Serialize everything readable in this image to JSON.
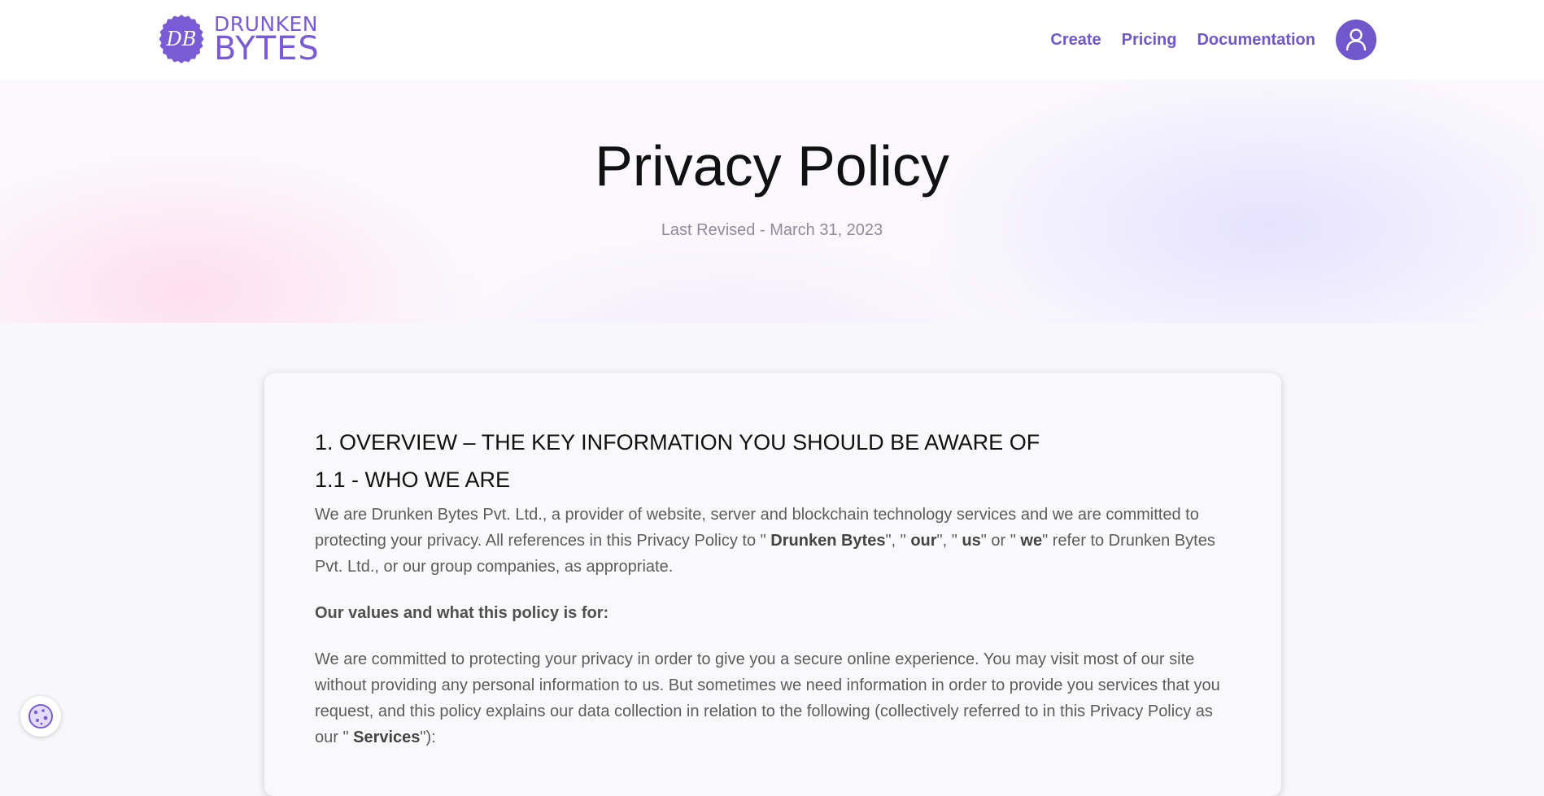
{
  "brand": {
    "logo_initials": "DB",
    "name_line1": "DRUNKEN",
    "name_line2": "BYTES",
    "color": "#7a5bd6"
  },
  "nav": {
    "create": "Create",
    "pricing": "Pricing",
    "documentation": "Documentation",
    "avatar_icon": "user-icon"
  },
  "hero": {
    "title": "Privacy Policy",
    "revised": "Last Revised - March 31, 2023"
  },
  "content": {
    "heading1": "1. OVERVIEW – THE KEY INFORMATION YOU SHOULD BE AWARE OF",
    "heading2": "1.1 - WHO WE ARE",
    "para1": {
      "t1": "We are Drunken Bytes Pvt. Ltd., a provider of website, server and blockchain technology services and we are committed to protecting your privacy. All references in this Privacy Policy to \" ",
      "b1": "Drunken Bytes",
      "t2": "\", \" ",
      "b2": "our",
      "t3": "\", \" ",
      "b3": "us",
      "t4": "\" or \" ",
      "b4": "we",
      "t5": "\" refer to Drunken Bytes Pvt. Ltd., or our group companies, as appropriate."
    },
    "values_heading": "Our values and what this policy is for:",
    "para2": {
      "t1": "We are committed to protecting your privacy in order to give you a secure online experience. You may visit most of our site without providing any personal information to us. But sometimes we need information in order to provide you services that you request, and this policy explains our data collection in relation to the following (collectively referred to in this Privacy Policy as our \" ",
      "b1": "Services",
      "t2": "\"):"
    }
  },
  "cookie_button": {
    "icon": "cookie-icon"
  },
  "colors": {
    "accent": "#7057cc",
    "nav_text": "#6f58c9",
    "body_text": "#5c5c5c"
  }
}
